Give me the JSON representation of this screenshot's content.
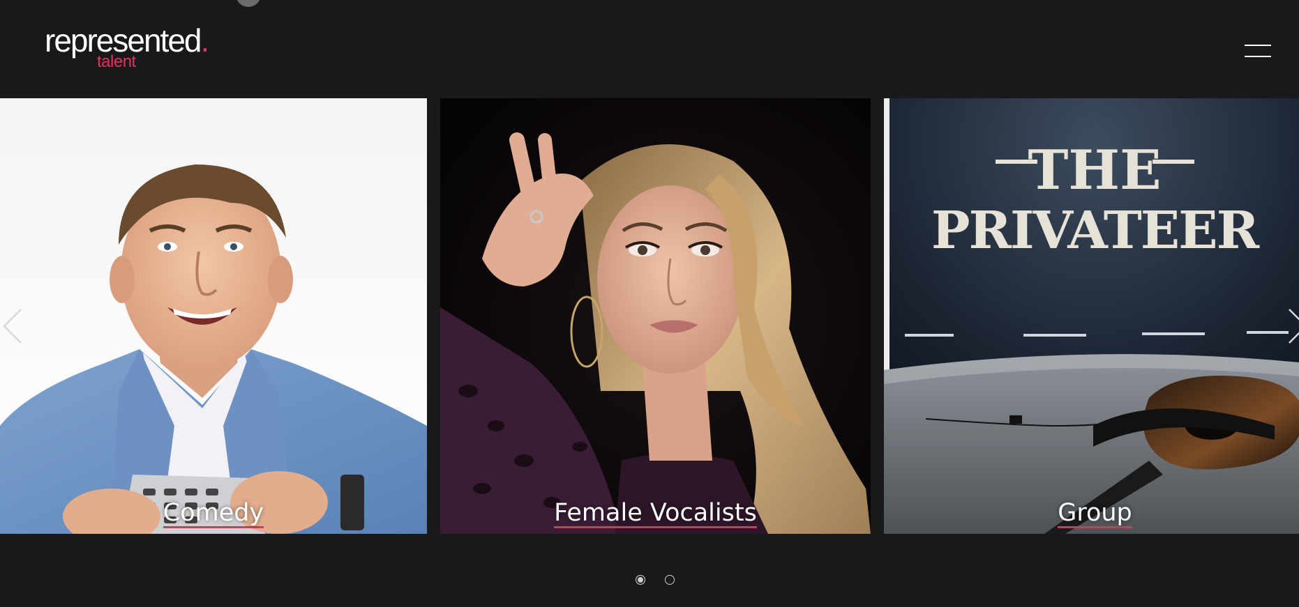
{
  "brand": {
    "name": "represented",
    "name_dot": ".",
    "sub": "talent",
    "accent_color": "#e1325b",
    "background_color": "#19191b"
  },
  "header": {
    "menu_icon": "hamburger-menu-icon"
  },
  "slider": {
    "slides": [
      {
        "label": "Comedy"
      },
      {
        "label": "Female Vocalists"
      },
      {
        "label": "Group"
      }
    ],
    "prev_icon": "chevron-left-icon",
    "next_icon": "chevron-right-icon",
    "active_page": 1,
    "page_count": 2
  }
}
